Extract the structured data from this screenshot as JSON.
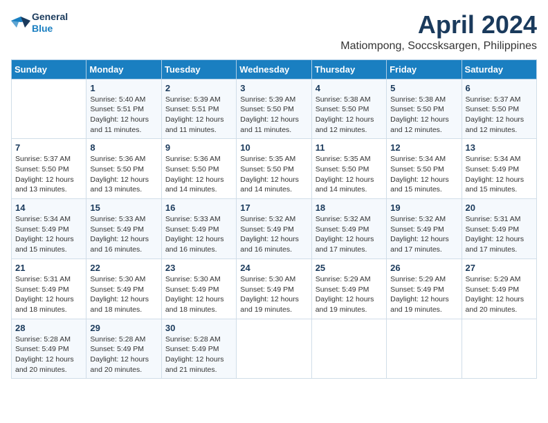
{
  "logo": {
    "line1": "General",
    "line2": "Blue"
  },
  "title": "April 2024",
  "subtitle": "Matiompong, Soccsksargen, Philippines",
  "weekdays": [
    "Sunday",
    "Monday",
    "Tuesday",
    "Wednesday",
    "Thursday",
    "Friday",
    "Saturday"
  ],
  "weeks": [
    [
      {
        "day": "",
        "info": ""
      },
      {
        "day": "1",
        "info": "Sunrise: 5:40 AM\nSunset: 5:51 PM\nDaylight: 12 hours\nand 11 minutes."
      },
      {
        "day": "2",
        "info": "Sunrise: 5:39 AM\nSunset: 5:51 PM\nDaylight: 12 hours\nand 11 minutes."
      },
      {
        "day": "3",
        "info": "Sunrise: 5:39 AM\nSunset: 5:50 PM\nDaylight: 12 hours\nand 11 minutes."
      },
      {
        "day": "4",
        "info": "Sunrise: 5:38 AM\nSunset: 5:50 PM\nDaylight: 12 hours\nand 12 minutes."
      },
      {
        "day": "5",
        "info": "Sunrise: 5:38 AM\nSunset: 5:50 PM\nDaylight: 12 hours\nand 12 minutes."
      },
      {
        "day": "6",
        "info": "Sunrise: 5:37 AM\nSunset: 5:50 PM\nDaylight: 12 hours\nand 12 minutes."
      }
    ],
    [
      {
        "day": "7",
        "info": "Sunrise: 5:37 AM\nSunset: 5:50 PM\nDaylight: 12 hours\nand 13 minutes."
      },
      {
        "day": "8",
        "info": "Sunrise: 5:36 AM\nSunset: 5:50 PM\nDaylight: 12 hours\nand 13 minutes."
      },
      {
        "day": "9",
        "info": "Sunrise: 5:36 AM\nSunset: 5:50 PM\nDaylight: 12 hours\nand 14 minutes."
      },
      {
        "day": "10",
        "info": "Sunrise: 5:35 AM\nSunset: 5:50 PM\nDaylight: 12 hours\nand 14 minutes."
      },
      {
        "day": "11",
        "info": "Sunrise: 5:35 AM\nSunset: 5:50 PM\nDaylight: 12 hours\nand 14 minutes."
      },
      {
        "day": "12",
        "info": "Sunrise: 5:34 AM\nSunset: 5:50 PM\nDaylight: 12 hours\nand 15 minutes."
      },
      {
        "day": "13",
        "info": "Sunrise: 5:34 AM\nSunset: 5:49 PM\nDaylight: 12 hours\nand 15 minutes."
      }
    ],
    [
      {
        "day": "14",
        "info": "Sunrise: 5:34 AM\nSunset: 5:49 PM\nDaylight: 12 hours\nand 15 minutes."
      },
      {
        "day": "15",
        "info": "Sunrise: 5:33 AM\nSunset: 5:49 PM\nDaylight: 12 hours\nand 16 minutes."
      },
      {
        "day": "16",
        "info": "Sunrise: 5:33 AM\nSunset: 5:49 PM\nDaylight: 12 hours\nand 16 minutes."
      },
      {
        "day": "17",
        "info": "Sunrise: 5:32 AM\nSunset: 5:49 PM\nDaylight: 12 hours\nand 16 minutes."
      },
      {
        "day": "18",
        "info": "Sunrise: 5:32 AM\nSunset: 5:49 PM\nDaylight: 12 hours\nand 17 minutes."
      },
      {
        "day": "19",
        "info": "Sunrise: 5:32 AM\nSunset: 5:49 PM\nDaylight: 12 hours\nand 17 minutes."
      },
      {
        "day": "20",
        "info": "Sunrise: 5:31 AM\nSunset: 5:49 PM\nDaylight: 12 hours\nand 17 minutes."
      }
    ],
    [
      {
        "day": "21",
        "info": "Sunrise: 5:31 AM\nSunset: 5:49 PM\nDaylight: 12 hours\nand 18 minutes."
      },
      {
        "day": "22",
        "info": "Sunrise: 5:30 AM\nSunset: 5:49 PM\nDaylight: 12 hours\nand 18 minutes."
      },
      {
        "day": "23",
        "info": "Sunrise: 5:30 AM\nSunset: 5:49 PM\nDaylight: 12 hours\nand 18 minutes."
      },
      {
        "day": "24",
        "info": "Sunrise: 5:30 AM\nSunset: 5:49 PM\nDaylight: 12 hours\nand 19 minutes."
      },
      {
        "day": "25",
        "info": "Sunrise: 5:29 AM\nSunset: 5:49 PM\nDaylight: 12 hours\nand 19 minutes."
      },
      {
        "day": "26",
        "info": "Sunrise: 5:29 AM\nSunset: 5:49 PM\nDaylight: 12 hours\nand 19 minutes."
      },
      {
        "day": "27",
        "info": "Sunrise: 5:29 AM\nSunset: 5:49 PM\nDaylight: 12 hours\nand 20 minutes."
      }
    ],
    [
      {
        "day": "28",
        "info": "Sunrise: 5:28 AM\nSunset: 5:49 PM\nDaylight: 12 hours\nand 20 minutes."
      },
      {
        "day": "29",
        "info": "Sunrise: 5:28 AM\nSunset: 5:49 PM\nDaylight: 12 hours\nand 20 minutes."
      },
      {
        "day": "30",
        "info": "Sunrise: 5:28 AM\nSunset: 5:49 PM\nDaylight: 12 hours\nand 21 minutes."
      },
      {
        "day": "",
        "info": ""
      },
      {
        "day": "",
        "info": ""
      },
      {
        "day": "",
        "info": ""
      },
      {
        "day": "",
        "info": ""
      }
    ]
  ]
}
